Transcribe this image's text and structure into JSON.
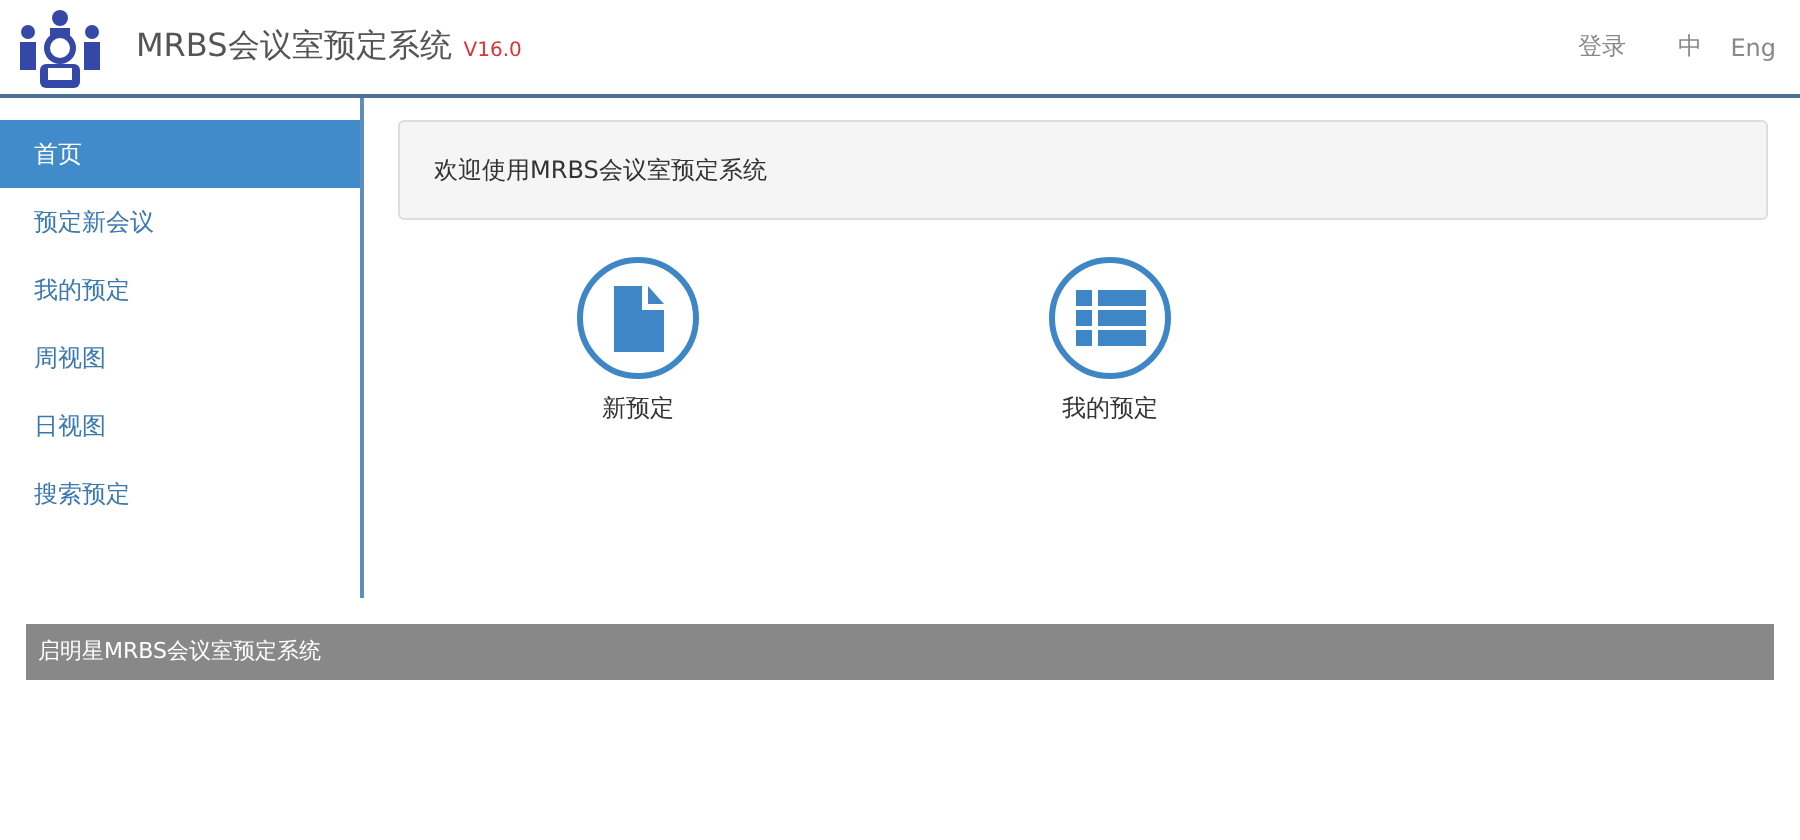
{
  "header": {
    "title": "MRBS会议室预定系统",
    "version": "V16.0",
    "links": [
      {
        "label": "登录",
        "kind": "login"
      },
      {
        "label": "中",
        "kind": "lang"
      },
      {
        "label": "Eng",
        "kind": "lang"
      }
    ]
  },
  "sidebar": {
    "items": [
      {
        "label": "首页",
        "selected": true
      },
      {
        "label": "预定新会议",
        "selected": false
      },
      {
        "label": "我的预定",
        "selected": false
      },
      {
        "label": "周视图",
        "selected": false
      },
      {
        "label": "日视图",
        "selected": false
      },
      {
        "label": "搜索预定",
        "selected": false
      }
    ]
  },
  "welcome": "欢迎使用MRBS会议室预定系统",
  "shortcuts": [
    {
      "label": "新预定",
      "kind": "document"
    },
    {
      "label": "我的预定",
      "kind": "list"
    }
  ],
  "footer": "启明星MRBS会议室预定系统"
}
